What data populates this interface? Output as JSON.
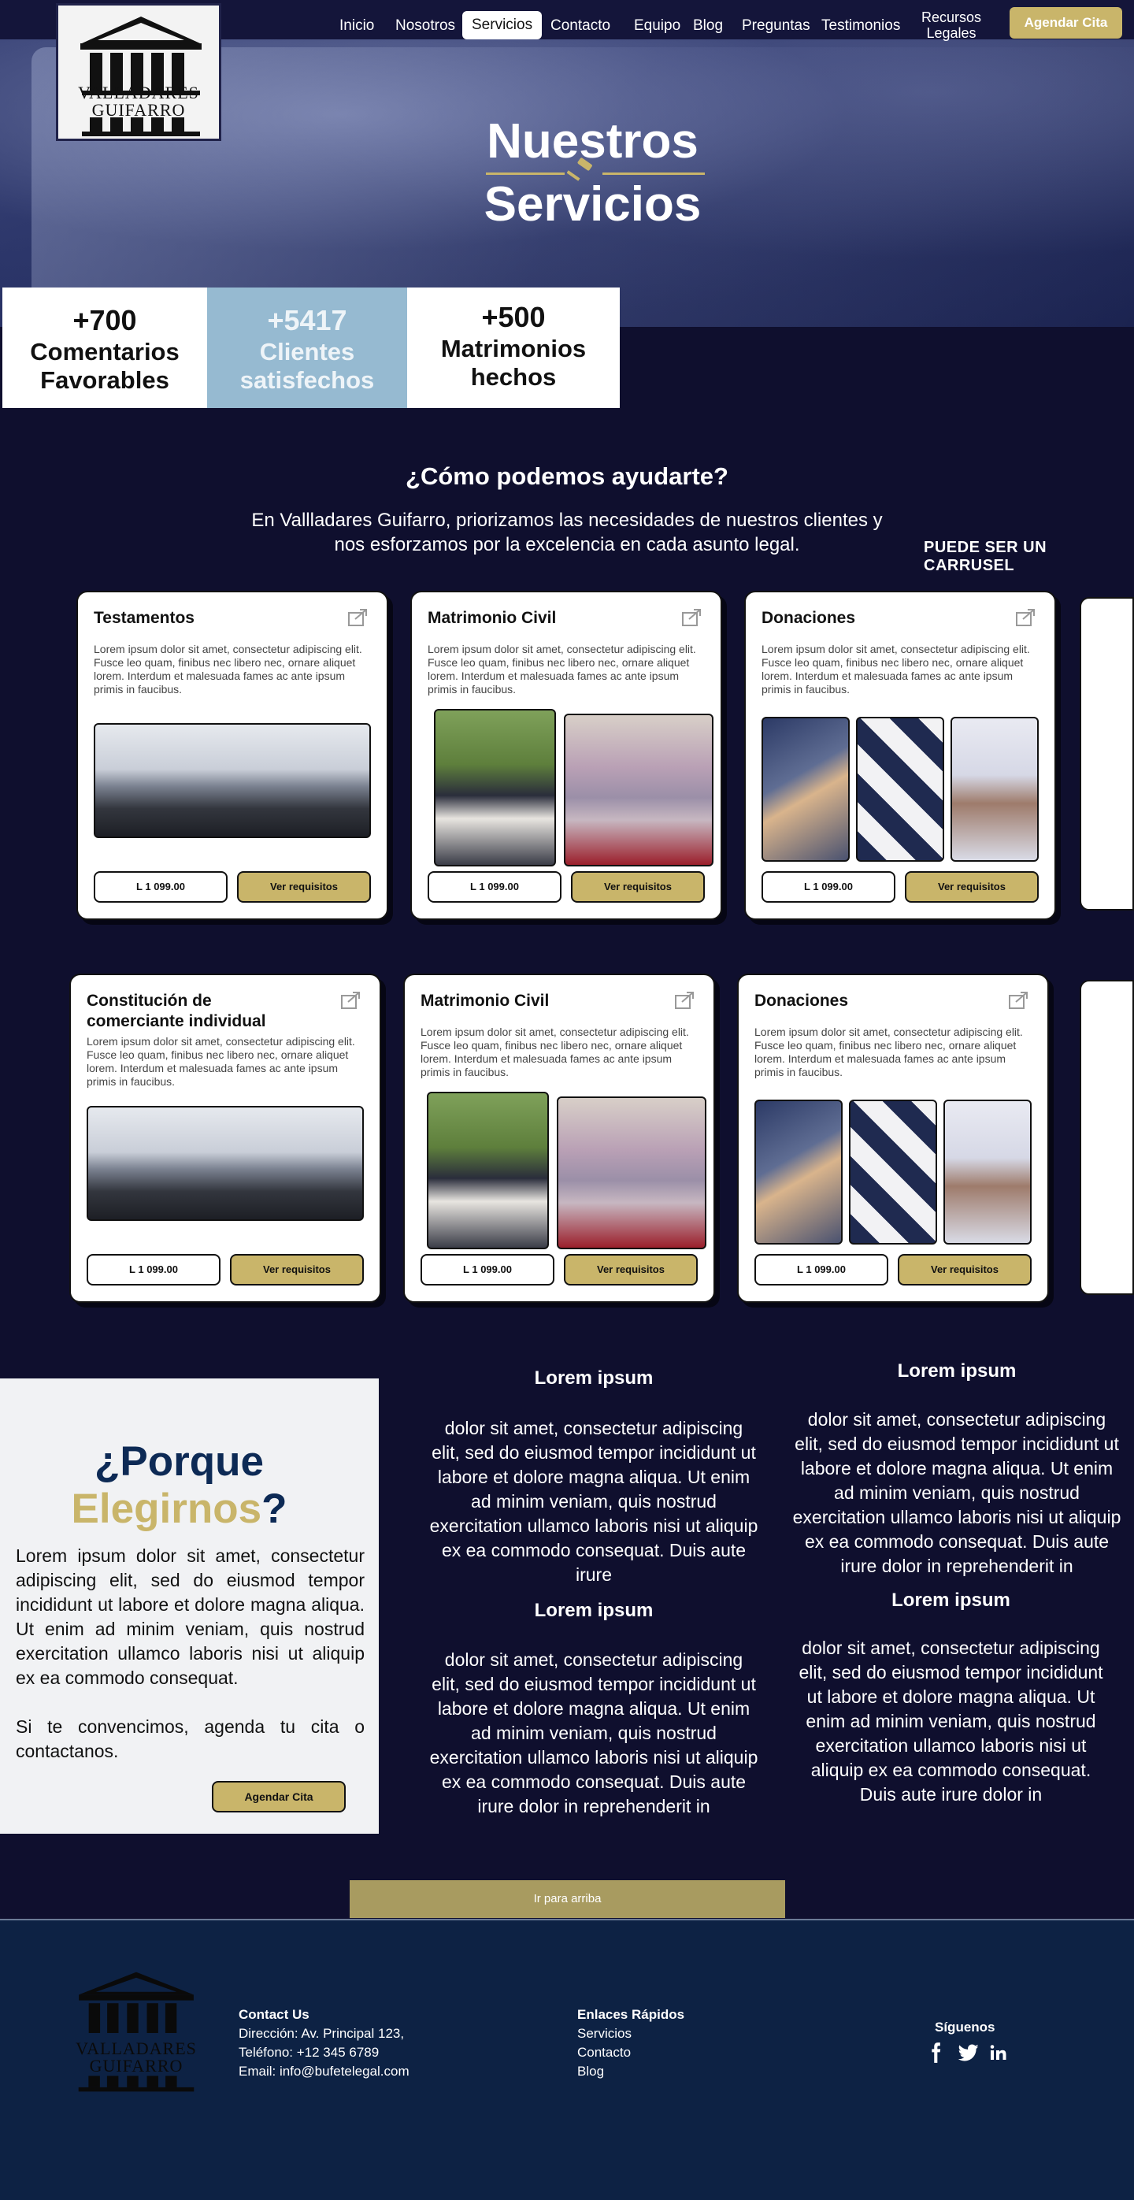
{
  "brand": {
    "name_line1": "VALLADARES",
    "name_line2": "GUIFARRO"
  },
  "nav": {
    "items": [
      "Inicio",
      "Nosotros",
      "Servicios",
      "Contacto",
      "Equipo",
      "Blog",
      "Preguntas",
      "Testimonios"
    ],
    "resources_line1": "Recursos",
    "resources_line2": "Legales",
    "active": "Servicios",
    "cta": "Agendar Cita"
  },
  "hero": {
    "title_line1": "Nuestros",
    "title_line2": "Servicios"
  },
  "stats": [
    {
      "value": "+700",
      "label_line1": "Comentarios",
      "label_line2": "Favorables"
    },
    {
      "value": "+5417",
      "label_line1": "Clientes",
      "label_line2": "satisfechos"
    },
    {
      "value": "+500",
      "label_line1": "Matrimonios",
      "label_line2": "hechos"
    }
  ],
  "help": {
    "title": "¿Cómo podemos ayudarte?",
    "subtitle": "En Vallladares Guifarro, priorizamos las necesidades de nuestros clientes y nos esforzamos por la excelencia en cada asunto legal.",
    "carousel_note": "PUEDE SER UN CARRUSEL"
  },
  "cards_row1": [
    {
      "title": "Testamentos",
      "desc": "Lorem ipsum dolor sit amet, consectetur adipiscing elit. Fusce leo quam, finibus nec libero nec, ornare aliquet lorem. Interdum et malesuada fames ac ante ipsum primis in faucibus.",
      "price": "L 1 099.00",
      "cta": "Ver requisitos"
    },
    {
      "title": "Matrimonio Civil",
      "desc": "Lorem ipsum dolor sit amet, consectetur adipiscing elit. Fusce leo quam, finibus nec libero nec, ornare aliquet lorem. Interdum et malesuada fames ac ante ipsum primis in faucibus.",
      "price": "L 1 099.00",
      "cta": "Ver requisitos"
    },
    {
      "title": "Donaciones",
      "desc": "Lorem ipsum dolor sit amet, consectetur adipiscing elit. Fusce leo quam, finibus nec libero nec, ornare aliquet lorem. Interdum et malesuada fames ac ante ipsum primis in faucibus.",
      "price": "L 1 099.00",
      "cta": "Ver requisitos"
    }
  ],
  "cards_row2": [
    {
      "title": "Constitución de comerciante individual",
      "desc": "Lorem ipsum dolor sit amet, consectetur adipiscing elit. Fusce leo quam, finibus nec libero nec, ornare aliquet lorem. Interdum et malesuada fames ac ante ipsum primis in faucibus.",
      "price": "L 1 099.00",
      "cta": "Ver requisitos"
    },
    {
      "title": "Matrimonio Civil",
      "desc": "Lorem ipsum dolor sit amet, consectetur adipiscing elit. Fusce leo quam, finibus nec libero nec, ornare aliquet lorem. Interdum et malesuada fames ac ante ipsum primis in faucibus.",
      "price": "L 1 099.00",
      "cta": "Ver requisitos"
    },
    {
      "title": "Donaciones",
      "desc": "Lorem ipsum dolor sit amet, consectetur adipiscing elit. Fusce leo quam, finibus nec libero nec, ornare aliquet lorem. Interdum et malesuada fames ac ante ipsum primis in faucibus.",
      "price": "L 1 099.00",
      "cta": "Ver requisitos"
    }
  ],
  "why": {
    "title_part1": "¿Porque",
    "title_part2": "Elegirnos",
    "title_part3": "?",
    "text1": "Lorem ipsum dolor sit amet, consectetur adipiscing elit, sed do eiusmod tempor incididunt ut labore et dolore magna aliqua. Ut enim ad minim veniam, quis nostrud exercitation ullamco laboris nisi ut aliquip ex ea commodo consequat.",
    "text2": "Si te convencimos, agenda tu cita o contactanos.",
    "cta": "Agendar Cita"
  },
  "lorem_blocks": [
    {
      "head": "Lorem ipsum",
      "body": "dolor sit amet, consectetur adipiscing elit, sed do eiusmod tempor incididunt ut labore et dolore magna aliqua. Ut enim ad minim veniam, quis nostrud exercitation ullamco laboris nisi ut aliquip ex ea commodo consequat. Duis aute irure"
    },
    {
      "head": "Lorem ipsum",
      "body": "dolor sit amet, consectetur adipiscing elit, sed do eiusmod tempor incididunt ut labore et dolore magna aliqua. Ut enim ad minim veniam, quis nostrud exercitation ullamco laboris nisi ut aliquip ex ea commodo consequat. Duis aute irure dolor in reprehenderit in"
    },
    {
      "head": "Lorem ipsum",
      "body": "dolor sit amet, consectetur adipiscing elit, sed do eiusmod tempor incididunt ut labore et dolore magna aliqua. Ut enim ad minim veniam, quis nostrud exercitation ullamco laboris nisi ut aliquip ex ea commodo consequat. Duis aute irure dolor in reprehenderit in"
    },
    {
      "head": "Lorem ipsum",
      "body": "dolor sit amet, consectetur adipiscing elit, sed do eiusmod tempor incididunt ut labore et dolore magna aliqua. Ut enim ad minim veniam, quis nostrud exercitation ullamco laboris nisi ut aliquip ex ea commodo consequat. Duis aute irure dolor in"
    }
  ],
  "back_to_top": "Ir para arriba",
  "footer": {
    "contact_title": "Contact Us",
    "address": "Dirección: Av. Principal 123,",
    "phone": "Teléfono: +12 345 6789",
    "email": "Email: info@bufetelegal.com",
    "links_title": "Enlaces Rápidos",
    "links": [
      "Servicios",
      "Contacto",
      "Blog"
    ],
    "follow_title": "Síguenos",
    "social_icons": [
      "facebook-icon",
      "twitter-icon",
      "linkedin-icon"
    ]
  },
  "colors": {
    "navy": "#0f0f2e",
    "gold": "#c9b56a",
    "stat_highlight": "#96bad1",
    "footer": "#0d2244"
  }
}
